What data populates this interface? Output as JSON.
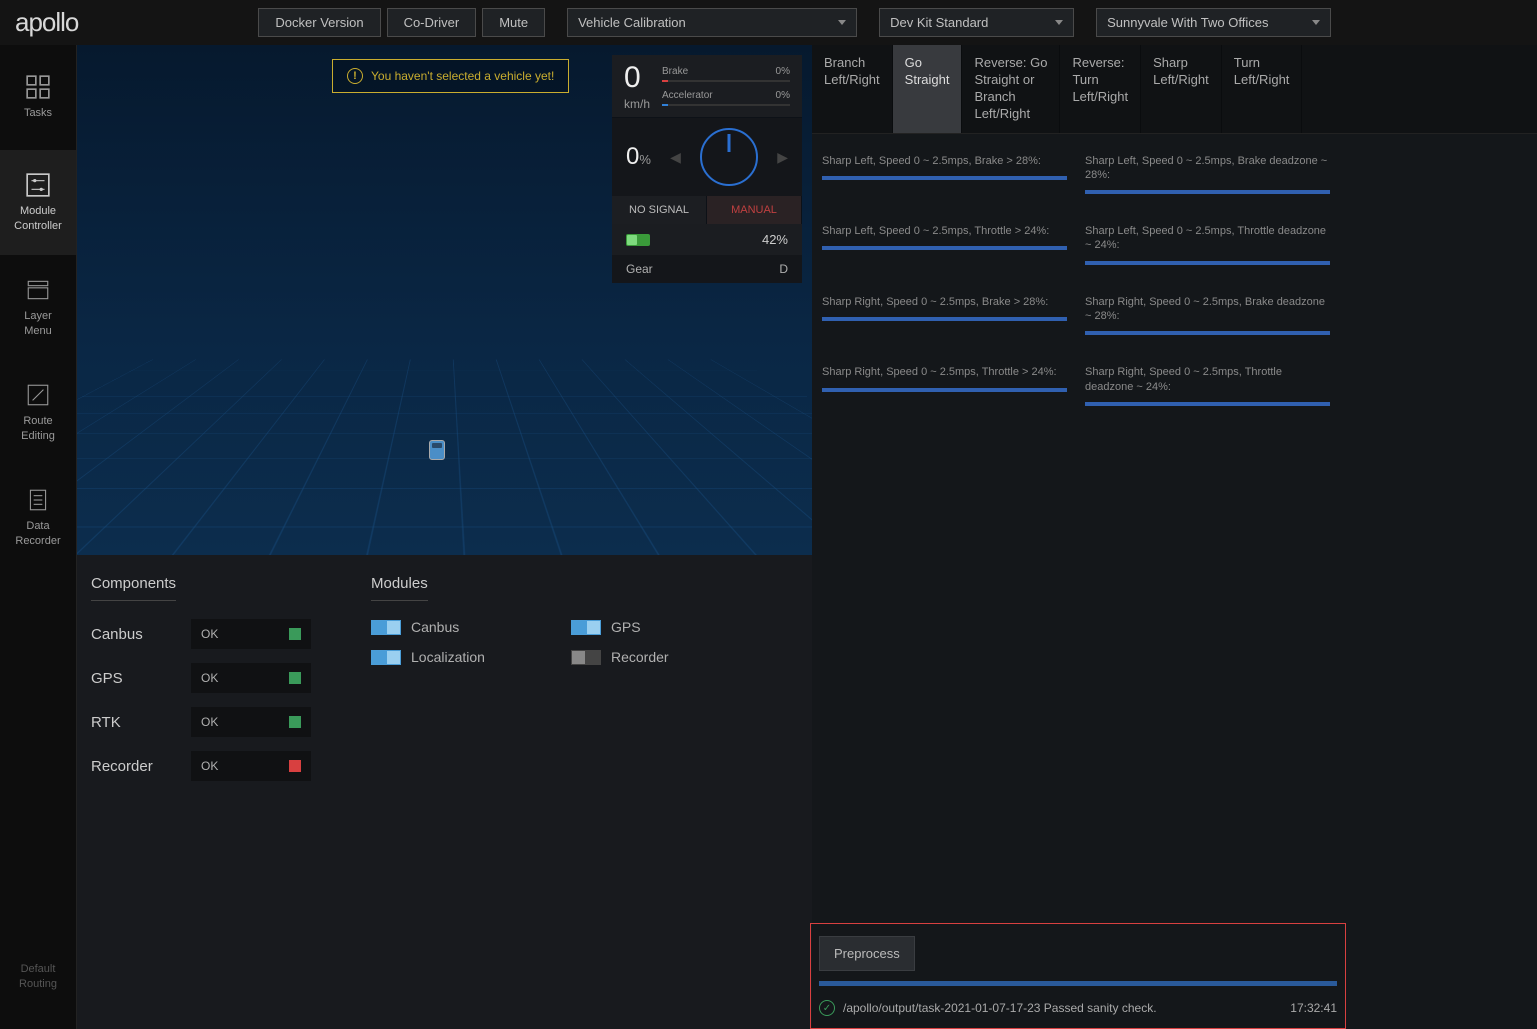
{
  "logo": "apollo",
  "header_buttons": [
    "Docker Version",
    "Co-Driver",
    "Mute"
  ],
  "selectors": {
    "mode": "Vehicle Calibration",
    "kit": "Dev Kit Standard",
    "map": "Sunnyvale With Two Offices"
  },
  "sidebar": [
    {
      "label": "Tasks"
    },
    {
      "label": "Module\nController"
    },
    {
      "label": "Layer\nMenu"
    },
    {
      "label": "Route\nEditing"
    },
    {
      "label": "Data\nRecorder"
    }
  ],
  "sidebar_bottom": "Default\nRouting",
  "warning": "You haven't selected a vehicle yet!",
  "hud": {
    "speed": "0",
    "speed_unit": "km/h",
    "brake_label": "Brake",
    "brake_pct": "0%",
    "accel_label": "Accelerator",
    "accel_pct": "0%",
    "steer": "0",
    "steer_unit": "%",
    "signal": "NO SIGNAL",
    "mode": "MANUAL",
    "battery": "42%",
    "gear_label": "Gear",
    "gear_value": "D"
  },
  "components_title": "Components",
  "components": [
    {
      "name": "Canbus",
      "status": "OK",
      "color": "green"
    },
    {
      "name": "GPS",
      "status": "OK",
      "color": "green"
    },
    {
      "name": "RTK",
      "status": "OK",
      "color": "green"
    },
    {
      "name": "Recorder",
      "status": "OK",
      "color": "red"
    }
  ],
  "modules_title": "Modules",
  "modules": [
    {
      "name": "Canbus",
      "on": true
    },
    {
      "name": "GPS",
      "on": true
    },
    {
      "name": "Localization",
      "on": true
    },
    {
      "name": "Recorder",
      "on": false
    }
  ],
  "scenario_tabs": [
    "Branch\nLeft/Right",
    "Go\nStraight",
    "Reverse: Go\nStraight or\nBranch\nLeft/Right",
    "Reverse:\nTurn\nLeft/Right",
    "Sharp\nLeft/Right",
    "Turn\nLeft/Right"
  ],
  "metrics": [
    "Sharp Left, Speed 0 ~ 2.5mps, Brake > 28%:",
    "Sharp Left, Speed 0 ~ 2.5mps, Brake deadzone ~ 28%:",
    "Sharp Left, Speed 0 ~ 2.5mps, Throttle > 24%:",
    "Sharp Left, Speed 0 ~ 2.5mps, Throttle deadzone ~ 24%:",
    "Sharp Right, Speed 0 ~ 2.5mps, Brake > 28%:",
    "Sharp Right, Speed 0 ~ 2.5mps, Brake deadzone ~ 28%:",
    "Sharp Right, Speed 0 ~ 2.5mps, Throttle > 24%:",
    "Sharp Right, Speed 0 ~ 2.5mps, Throttle deadzone ~ 24%:"
  ],
  "preprocess_label": "Preprocess",
  "log_path": "/apollo/output/task-2021-01-07-17-23 Passed sanity check.",
  "log_time": "17:32:41"
}
